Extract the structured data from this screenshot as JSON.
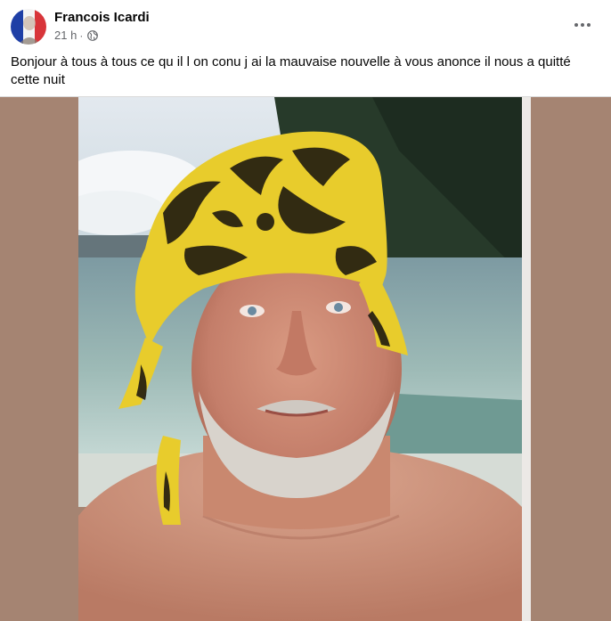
{
  "post": {
    "author": "Francois Icardi",
    "time": "21 h",
    "separator": "·",
    "privacy_icon": "globe-icon",
    "text": "Bonjour à tous à tous ce qu il l on conu j ai la mauvaise nouvelle à vous anonce il nous a quitté cette nuit",
    "more_icon": "more-horizontal-icon"
  },
  "colors": {
    "media_background": "#a58472",
    "bandana_yellow": "#e8cc2c",
    "flag_blue": "#1f3fa6",
    "flag_red": "#d8353a"
  }
}
